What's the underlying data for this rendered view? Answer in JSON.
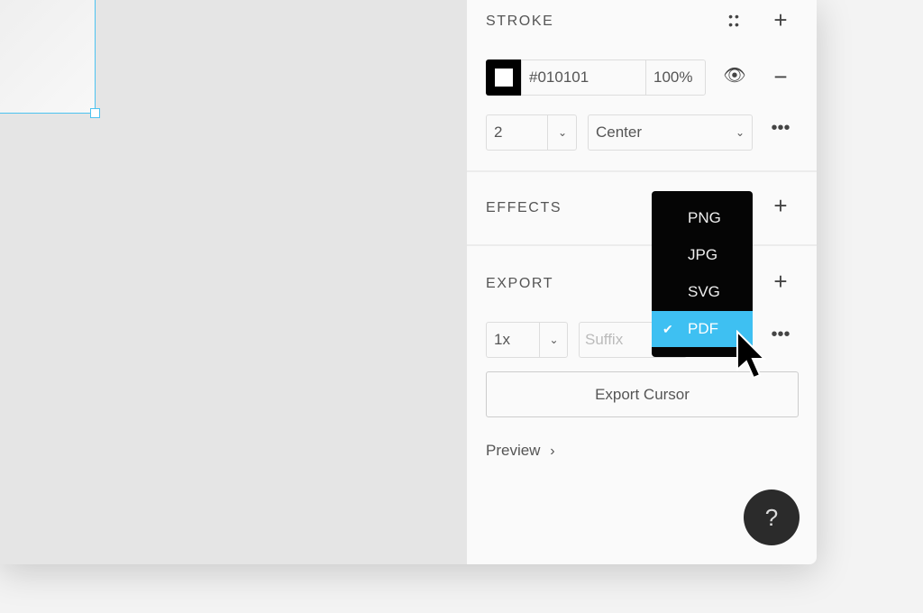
{
  "stroke": {
    "title": "STROKE",
    "color_hex": "#010101",
    "opacity": "100%",
    "weight": "2",
    "position": "Center"
  },
  "effects": {
    "title": "EFFECTS"
  },
  "export": {
    "title": "EXPORT",
    "scale": "1x",
    "suffix_placeholder": "Suffix",
    "export_button": "Export Cursor",
    "preview": "Preview",
    "preview_chevron": "›"
  },
  "format_menu": {
    "items": [
      "PNG",
      "JPG",
      "SVG",
      "PDF"
    ],
    "selected": "PDF",
    "check": "✔"
  },
  "help": {
    "label": "?"
  },
  "colors": {
    "accent": "#3ec0f2",
    "selection": "#4cc3f0",
    "menu_bg": "#050505"
  }
}
